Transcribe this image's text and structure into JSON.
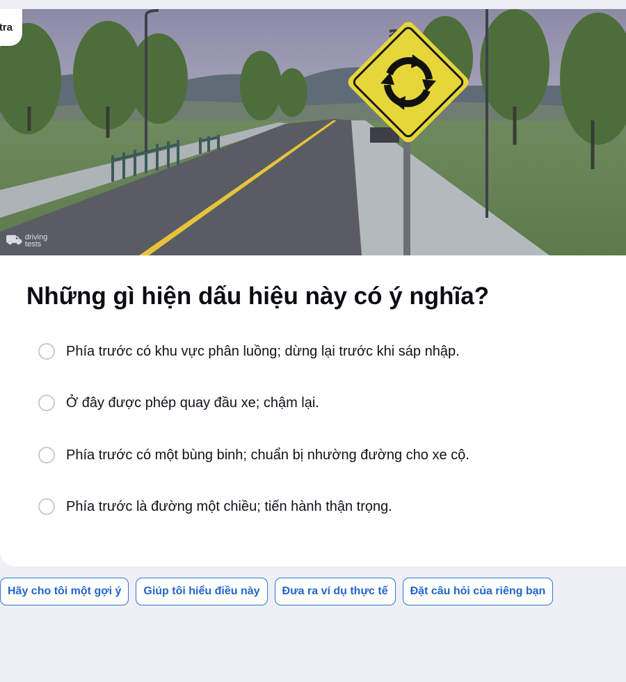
{
  "header": {
    "badge_label": "Kiểm tra"
  },
  "image": {
    "watermark_line1": "driving",
    "watermark_line2": "tests"
  },
  "question": {
    "text": "Những gì hiện dấu hiệu này có ý nghĩa?"
  },
  "options": [
    {
      "text": "Phía trước có khu vực phân luồng; dừng lại trước khi sáp nhập."
    },
    {
      "text": "Ở đây được phép quay đầu xe; chậm lại."
    },
    {
      "text": "Phía trước có một bùng binh; chuẩn bị nhường đường cho xe cộ."
    },
    {
      "text": "Phía trước là đường một chiều; tiến hành thận trọng."
    }
  ],
  "suggestions": [
    {
      "label": "Hãy cho tôi một gợi ý"
    },
    {
      "label": "Giúp tôi hiểu điều này"
    },
    {
      "label": "Đưa ra ví dụ thực tế"
    },
    {
      "label": "Đặt câu hỏi của riêng bạn"
    }
  ],
  "colors": {
    "accent": "#2266cc",
    "background": "#eff0f6",
    "sign_yellow": "#e8d83a"
  }
}
